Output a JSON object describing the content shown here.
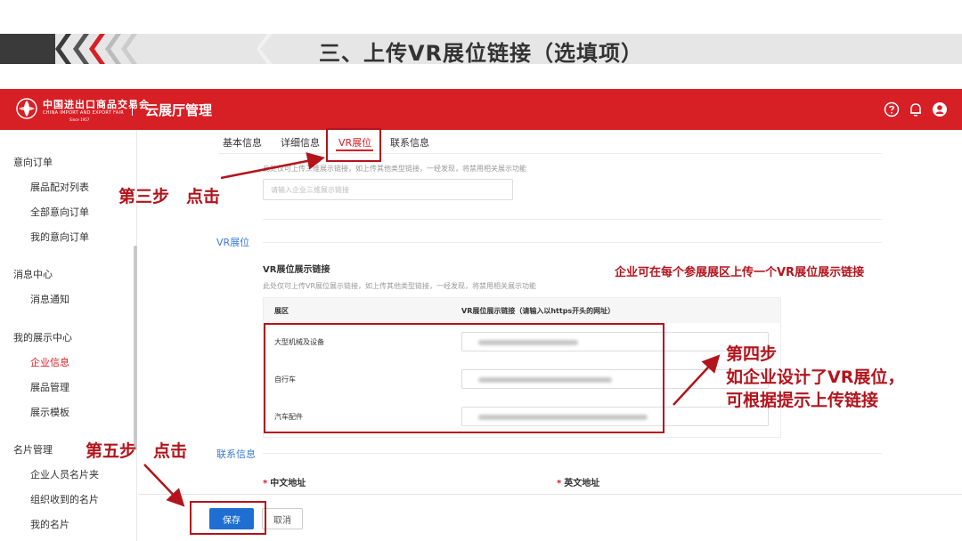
{
  "slide": {
    "title": "三、上传VR展位链接（选填项）"
  },
  "brand": {
    "logo_cn": "中国进出口商品交易会",
    "logo_en": "CHINA IMPORT AND EXPORT FAIR",
    "logo_since": "Since 1957",
    "app_name": "云展厅管理",
    "colors": {
      "primary": "#d71f26",
      "link": "#3d7ad6",
      "button": "#1f6fd2",
      "annotation": "#b3141c"
    }
  },
  "topbar_icons": [
    "help-circle-icon",
    "bell-icon",
    "user-icon"
  ],
  "sidebar": {
    "groups": [
      {
        "label": "意向订单",
        "items": [
          "展品配对列表",
          "全部意向订单",
          "我的意向订单"
        ]
      },
      {
        "label": "消息中心",
        "items": [
          "消息通知"
        ]
      },
      {
        "label": "我的展示中心",
        "items": [
          "企业信息",
          "展品管理",
          "展示模板"
        ]
      },
      {
        "label": "名片管理",
        "items": [
          "企业人员名片夹",
          "组织收到的名片",
          "我的名片"
        ]
      }
    ],
    "active_item": "企业信息"
  },
  "tabs": [
    {
      "label": "基本信息"
    },
    {
      "label": "详细信息"
    },
    {
      "label": "VR展位",
      "active": true
    },
    {
      "label": "联系信息"
    }
  ],
  "faded": {
    "desc": "此处仅可上传三维展示链接，如上传其他类型链接，一经发现，将禁用相关展示功能",
    "placeholder": "请输入企业三维展示链接"
  },
  "vr_section": {
    "title": "VR展位",
    "field_label": "VR展位展示链接",
    "field_desc": "此处仅可上传VR展位展示链接，如上传其他类型链接，一经发现，将禁用相关展示功能",
    "col_zone": "展区",
    "col_link": "VR展位展示链接（请输入以https开头的网址）",
    "rows": [
      {
        "zone": "大型机械及设备"
      },
      {
        "zone": "自行车"
      },
      {
        "zone": "汽车配件"
      }
    ]
  },
  "contact_section": {
    "title": "联系信息",
    "cn_address_label": "中文地址",
    "en_address_label": "英文地址",
    "required_mark": "*"
  },
  "footer": {
    "save": "保存",
    "cancel": "取消"
  },
  "annotations": {
    "step3": "第三步　点击",
    "note": "企业可在每个参展展区上传一个VR展位展示链接",
    "step4_line1": "第四步",
    "step4_line2": "如企业设计了VR展位，",
    "step4_line3": "可根据提示上传链接",
    "step5": "第五步　点击"
  }
}
